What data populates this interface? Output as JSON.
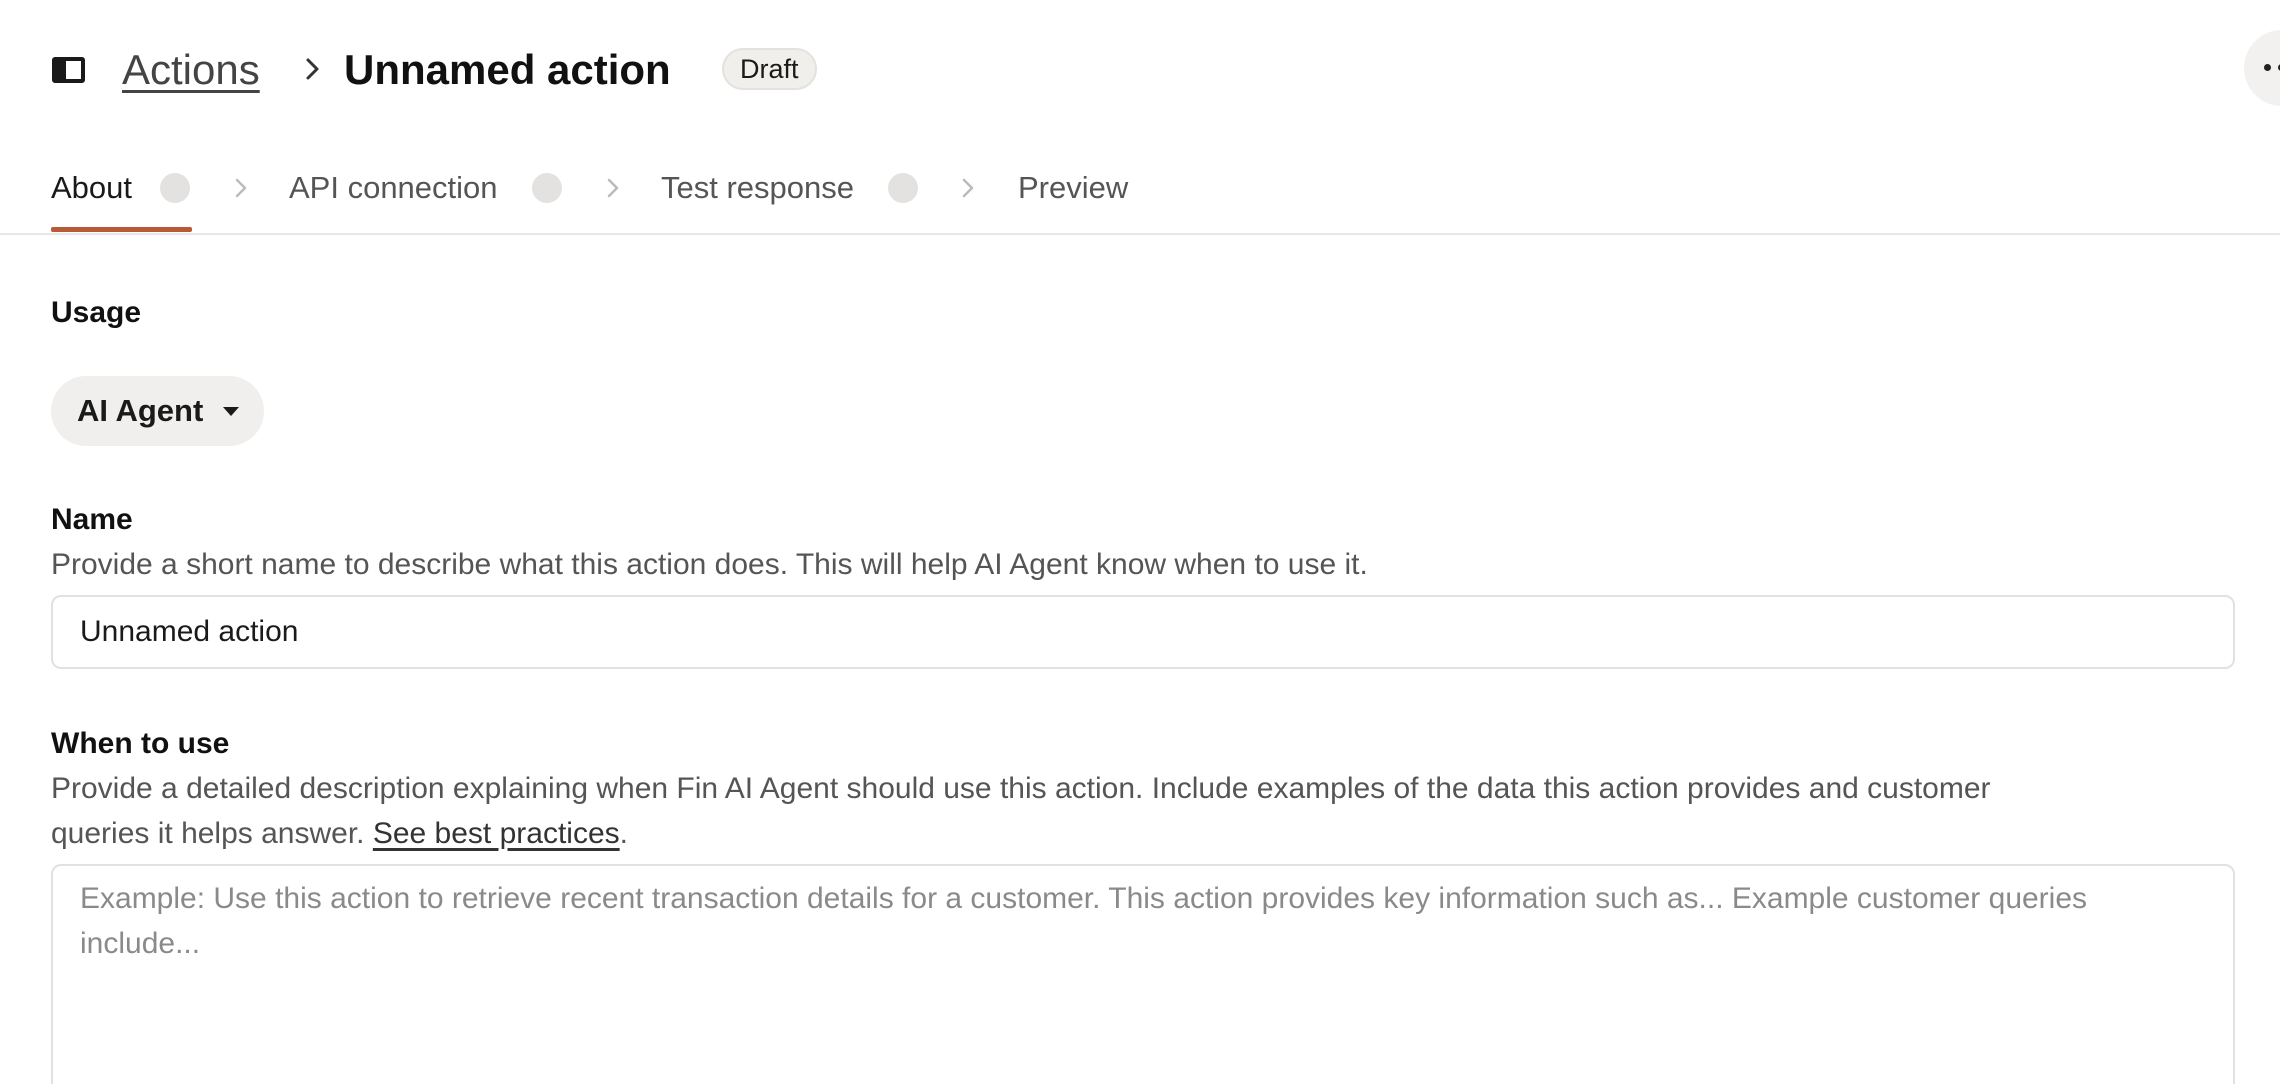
{
  "header": {
    "breadcrumb_parent": "Actions",
    "title": "Unnamed action",
    "status_badge": "Draft"
  },
  "tabs": [
    {
      "label": "About",
      "active": true
    },
    {
      "label": "API connection",
      "active": false
    },
    {
      "label": "Test response",
      "active": false
    },
    {
      "label": "Preview",
      "active": false
    }
  ],
  "form": {
    "usage": {
      "label": "Usage",
      "selected": "AI Agent"
    },
    "name": {
      "label": "Name",
      "help": "Provide a short name to describe what this action does. This will help AI Agent know when to use it.",
      "value": "Unnamed action"
    },
    "when_to_use": {
      "label": "When to use",
      "help_line1": "Provide a detailed description explaining when Fin AI Agent should use this action. Include examples of the data this action provides and customer",
      "help_line2_prefix": "queries it helps answer. ",
      "help_link": "See best practices",
      "help_line2_suffix": ".",
      "placeholder": "Example: Use this action to retrieve recent transaction details for a customer. This action provides key information such as... Example customer queries include..."
    }
  },
  "colors": {
    "accent_underline": "#b85a35",
    "badge_bg": "#f0efec",
    "step_dot": "#e3e2e0"
  },
  "icons": {
    "sidebar_toggle": "sidebar-toggle-icon",
    "breadcrumb_separator": "chevron-right-icon",
    "more": "more-horizontal-icon",
    "dropdown": "caret-down-icon"
  }
}
